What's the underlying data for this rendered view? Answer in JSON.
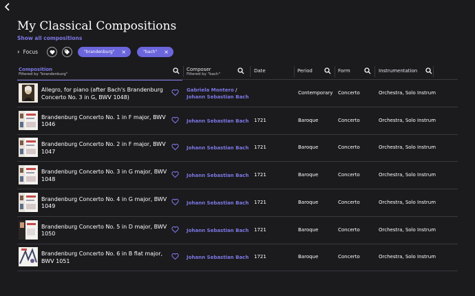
{
  "title": "My Classical Compositions",
  "show_all_label": "Show all compositions",
  "focus_label": "Focus",
  "filters": [
    {
      "label": "\"brandenburg\""
    },
    {
      "label": "\"bach\""
    }
  ],
  "columns": {
    "composition": {
      "label": "Composition",
      "sub": "Filtered by \"brandenburg\""
    },
    "composer": {
      "label": "Composer",
      "sub": "Filtered by \"bach\""
    },
    "date": {
      "label": "Date"
    },
    "period": {
      "label": "Period"
    },
    "form": {
      "label": "Form"
    },
    "instrumentation": {
      "label": "Instrumentation"
    }
  },
  "colors": {
    "accent": "#6b66dc",
    "link": "#7c78e4",
    "background": "#1b1a1d"
  },
  "rows": [
    {
      "title": "Allegro, for piano (after Bach's Brandenburg Concerto No. 3 in G, BWV 1048)",
      "composer1": "Gabriela Montero",
      "sep": "/",
      "composer2": "Johann Sebastian Bach",
      "date": "",
      "period": "Contemporary",
      "form": "Concerto",
      "instrumentation": "Orchestra, Solo Instrument",
      "thumb": "portrait"
    },
    {
      "title": "Brandenburg Concerto No. 1 in F major, BWV 1046",
      "composer1": "Johann Sebastian Bach",
      "sep": "",
      "composer2": "",
      "date": "1721",
      "period": "Baroque",
      "form": "Concerto",
      "instrumentation": "Orchestra, Solo Instrument",
      "thumb": "album"
    },
    {
      "title": "Brandenburg Concerto No. 2 in F major, BWV 1047",
      "composer1": "Johann Sebastian Bach",
      "sep": "",
      "composer2": "",
      "date": "1721",
      "period": "Baroque",
      "form": "Concerto",
      "instrumentation": "Orchestra, Solo Instrument",
      "thumb": "album"
    },
    {
      "title": "Brandenburg Concerto No. 3 in G major, BWV 1048",
      "composer1": "Johann Sebastian Bach",
      "sep": "",
      "composer2": "",
      "date": "1721",
      "period": "Baroque",
      "form": "Concerto",
      "instrumentation": "Orchestra, Solo Instrument",
      "thumb": "album"
    },
    {
      "title": "Brandenburg Concerto No. 4 in G major, BWV 1049",
      "composer1": "Johann Sebastian Bach",
      "sep": "",
      "composer2": "",
      "date": "1721",
      "period": "Baroque",
      "form": "Concerto",
      "instrumentation": "Orchestra, Solo Instrument",
      "thumb": "album"
    },
    {
      "title": "Brandenburg Concerto No. 5 in D major, BWV 1050",
      "composer1": "Johann Sebastian Bach",
      "sep": "",
      "composer2": "",
      "date": "1721",
      "period": "Baroque",
      "form": "Concerto",
      "instrumentation": "Orchestra, Solo Instrument",
      "thumb": "album2"
    },
    {
      "title": "Brandenburg Concerto No. 6 in B flat major, BWV 1051",
      "composer1": "Johann Sebastian Bach",
      "sep": "",
      "composer2": "",
      "date": "1721",
      "period": "Baroque",
      "form": "Concerto",
      "instrumentation": "Orchestra, Solo Instrument",
      "thumb": "album3"
    }
  ]
}
